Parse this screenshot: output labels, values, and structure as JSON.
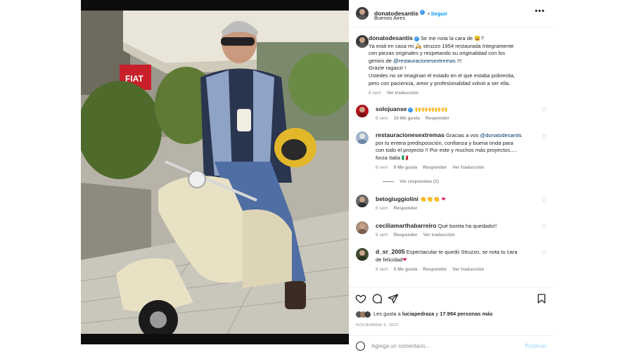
{
  "post": {
    "username": "donatodesantis",
    "follow_label": "Seguir",
    "location": "Buenos Aires",
    "more_label": "•••"
  },
  "caption": {
    "username": "donatodesantis",
    "line1": "Se me nota la cara de 😀?",
    "line2": "Ya está en casa mi 🛵 struzzo 1954 restaurada íntegramente",
    "line3": "con piezas originales y respetando su originalidad con los",
    "line4_prefix": "genios de ",
    "line4_mention": "@restauracionesextremas",
    "line4_suffix": " !!!",
    "line5": "Grazie ragazzi !",
    "line6": "Ustedes no se imaginan el estado en el que estaba pobrecita,",
    "line7": "pero con paciencia, amor y profesionalidad volvió a ser ella.",
    "time": "8 sem",
    "translate": "Ver traducción"
  },
  "comments": [
    {
      "user": "solojuanse",
      "text": "🙌🙌🙌🙌🙌",
      "time": "8 sem",
      "likes": "10 Me gusta",
      "reply": "Responder"
    },
    {
      "user": "restauracionesextremas",
      "text_prefix": "Gracias a vos ",
      "mention": "@donatodesantis",
      "line2": "por tu entera predisposición, confianza y buena onda para",
      "line3": "con todo el proyecto !! Por este y muchos más proyectos.....",
      "line4": "forza Italia 🇮🇹",
      "time": "8 sem",
      "likes": "9 Me gusta",
      "reply": "Responder",
      "translate": "Ver traducción",
      "view_replies": "Ver respuestas (1)"
    },
    {
      "user": "betogiuggiolini",
      "text": "👏👏👏",
      "time": "8 sem",
      "reply": "Responder"
    },
    {
      "user": "ceciliamarthabarreiro",
      "text": "Qué bonita ha quedado!!",
      "time": "8 sem",
      "reply": "Responder",
      "translate": "Ver traducción"
    },
    {
      "user": "d_sr_2005",
      "text": "Espectacular te quedó Struzzo, se nota tu cara",
      "line2": "de felicidad",
      "time": "8 sem",
      "likes": "5 Me gusta",
      "reply": "Responder",
      "translate": "Ver traducción"
    }
  ],
  "likes": {
    "prefix": "Les gusta a ",
    "user": "luciapedraza",
    "middle": " y ",
    "count": "17.994 personas más"
  },
  "date": "NOVIEMBRE 6, 2022",
  "add_comment": {
    "placeholder": "Agrega un comentario...",
    "publish": "Publicar"
  },
  "colors": {
    "accent": "#0095f6",
    "verified": "#3897f0",
    "muted": "#8e8e8e",
    "scooter": "#e8e1c4"
  }
}
